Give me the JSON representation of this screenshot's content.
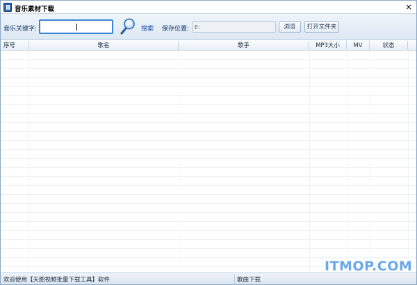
{
  "window": {
    "title": "音乐素材下载",
    "close_glyph": "×"
  },
  "toolbar": {
    "keyword_label": "音乐关键字:",
    "keyword_value": "",
    "search_label": "搜索",
    "save_label": "保存位置:",
    "save_path": "E:",
    "browse_label": "浏览",
    "open_folder_label": "打开文件夹"
  },
  "table": {
    "columns": [
      "序号",
      "歌名",
      "歌手",
      "MP3大小",
      "MV",
      "状态"
    ],
    "rows": []
  },
  "status": {
    "left": "欢迎使用【天图视频批量下载工具】软件",
    "right": "歌曲下载"
  },
  "watermark": "ITMOP.COM",
  "colors": {
    "accent": "#3a86d6",
    "watermark": "#6aa8e8"
  }
}
